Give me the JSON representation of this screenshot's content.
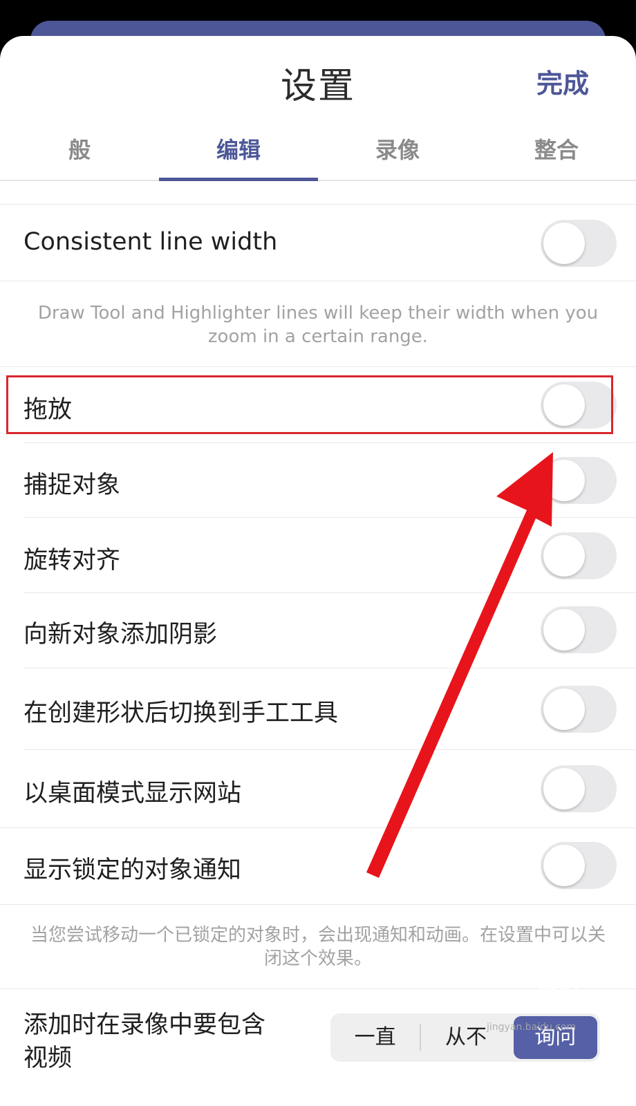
{
  "header": {
    "title": "设置",
    "done_label": "完成"
  },
  "tabs": [
    {
      "label": "般",
      "active": false
    },
    {
      "label": "编辑",
      "active": true
    },
    {
      "label": "录像",
      "active": false
    },
    {
      "label": "整合",
      "active": false
    }
  ],
  "settings": {
    "consistent_line_width": {
      "label": "Consistent line width",
      "on": false
    },
    "consistent_line_width_note": "Draw Tool and Highlighter lines will keep their width when you zoom in a certain range.",
    "drag_drop": {
      "label": "拖放",
      "on": false
    },
    "snap_objects": {
      "label": "捕捉对象",
      "on": false
    },
    "rotate_align": {
      "label": "旋转对齐",
      "on": false
    },
    "shadow_new_objects": {
      "label": "向新对象添加阴影",
      "on": false
    },
    "switch_to_hand_tool": {
      "label": "在创建形状后切换到手工工具",
      "on": false
    },
    "desktop_mode_sites": {
      "label": "以桌面模式显示网站",
      "on": false
    },
    "locked_object_notice": {
      "label": "显示锁定的对象通知",
      "on": false
    },
    "locked_object_note": "当您尝试移动一个已锁定的对象时，会出现通知和动画。在设置中可以关闭这个效果。",
    "include_video": {
      "label_line1": "添加时在录像中要包含",
      "label_line2": "视频",
      "options": [
        "一直",
        "从不",
        "询问"
      ],
      "selected": "询问"
    }
  },
  "annotation": {
    "highlight_color": "#d8262d",
    "arrow_color": "#e8141c"
  },
  "watermark": {
    "text": "Bai 经验",
    "sub": "jingyan.baidu.com"
  },
  "colors": {
    "accent": "#4d5797",
    "switch_off": "#e9e9eb",
    "background": "#ffffff"
  }
}
